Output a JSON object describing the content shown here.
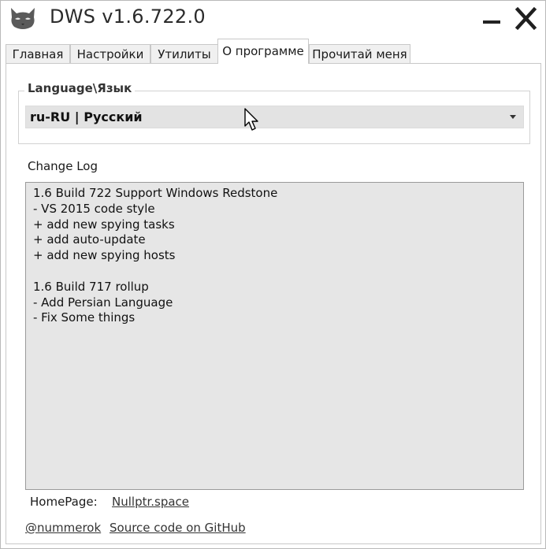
{
  "window": {
    "title": "DWS v1.6.722.0",
    "icon": "dws-cat-icon"
  },
  "tabs": [
    {
      "label": "Главная"
    },
    {
      "label": "Настройки"
    },
    {
      "label": "Утилиты"
    },
    {
      "label": "О программе",
      "active": true
    },
    {
      "label": "Прочитай меня"
    }
  ],
  "language": {
    "legend": "Language\\Язык",
    "selected": "ru-RU | Русский"
  },
  "changelog": {
    "label": "Change Log",
    "lines": [
      "1.6 Build 722 Support Windows Redstone",
      "- VS 2015 code style",
      "+ add new spying tasks",
      "+ add auto-update",
      "+ add new spying hosts",
      "",
      "1.6 Build 717 rollup",
      "- Add Persian Language",
      "- Fix Some things"
    ]
  },
  "footer": {
    "homepage_label": "HomePage:",
    "homepage_link": "Nullptr.space",
    "twitter_link": "@nummerok",
    "github_link": "Source code on GitHub"
  },
  "colors": {
    "changelog_bg": "#e6e6e6",
    "select_bg": "#e3e3e3",
    "tab_inactive_bg": "#f0f0f0"
  }
}
